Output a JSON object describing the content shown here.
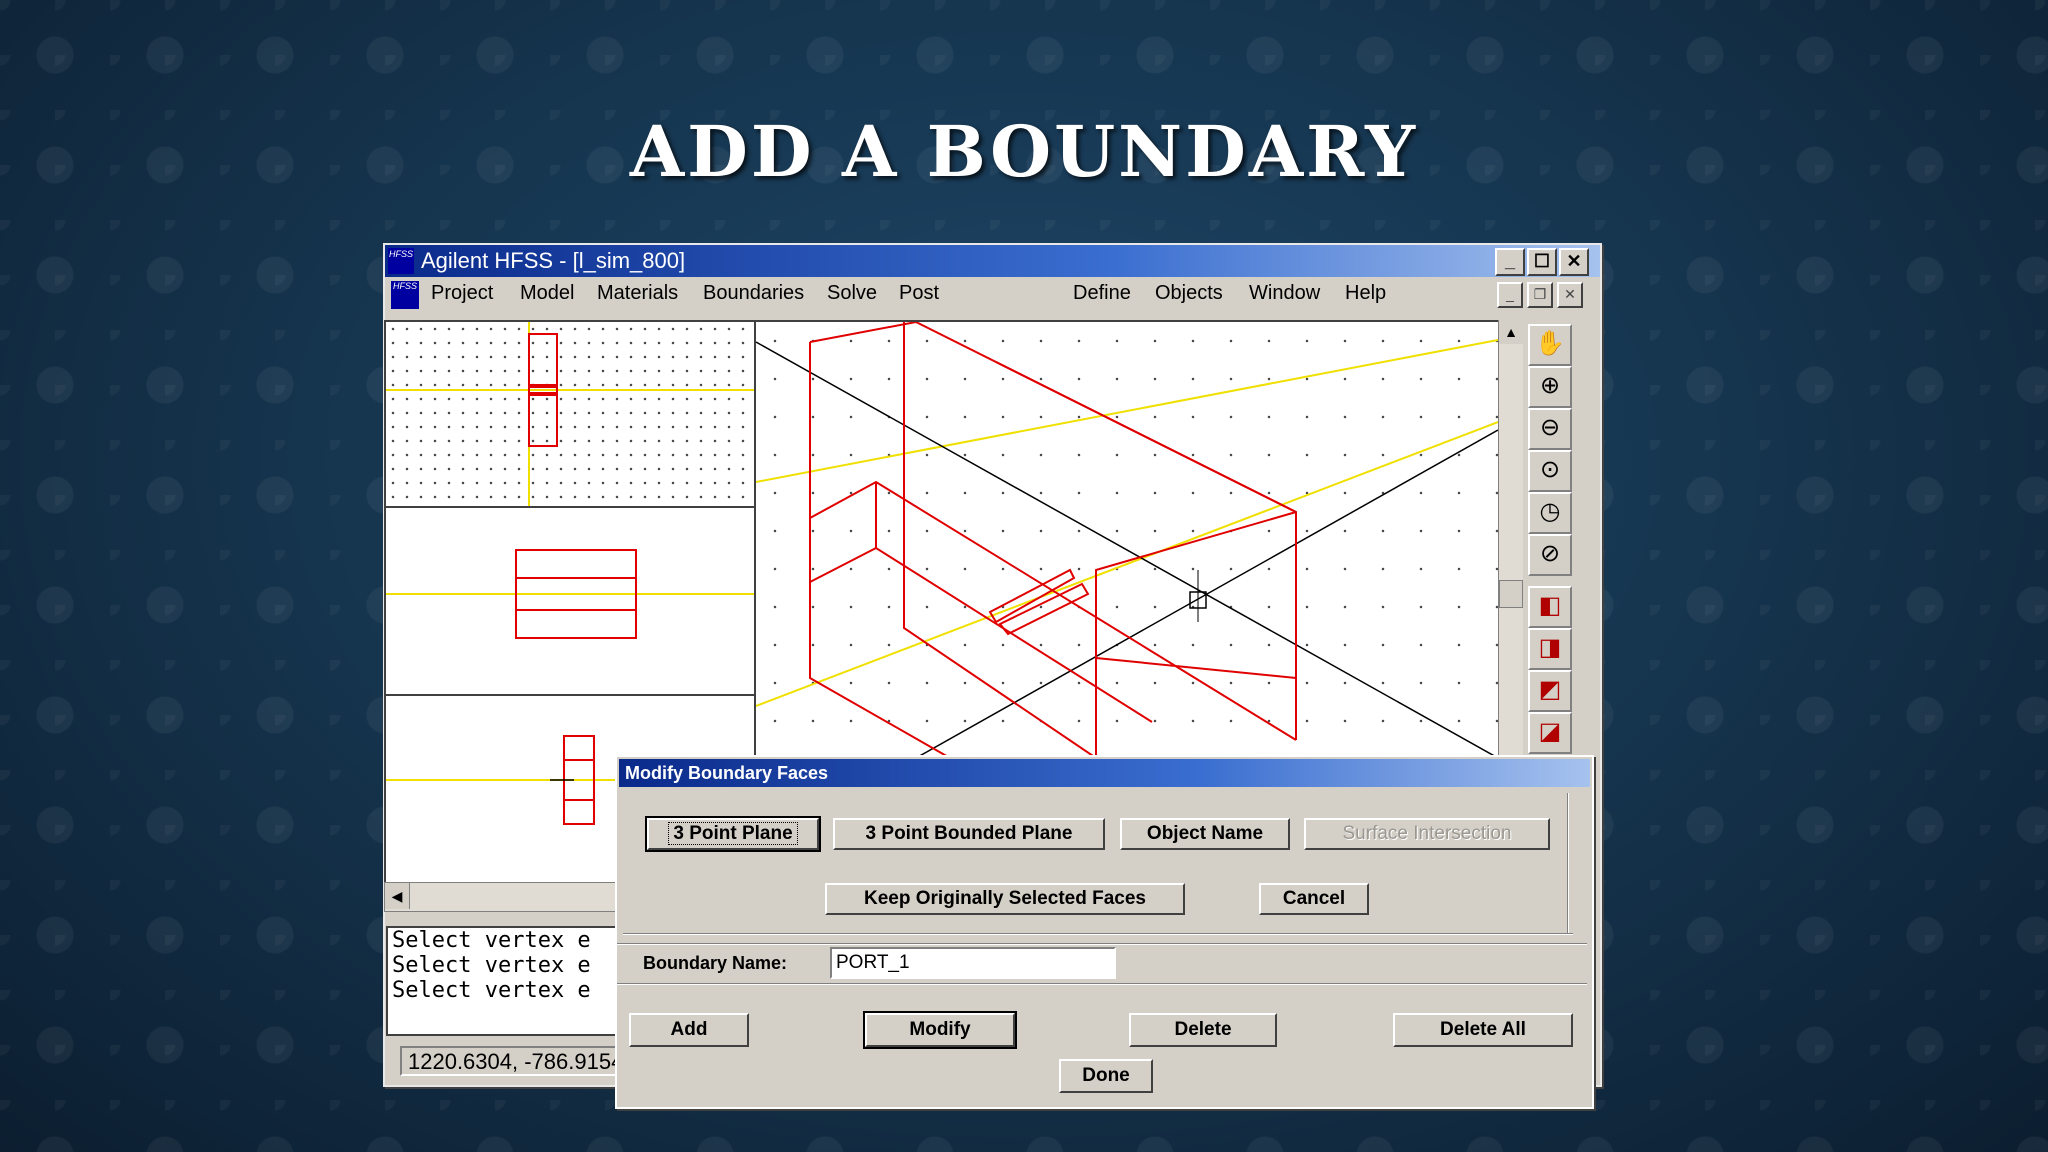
{
  "slide": {
    "title": "ADD A BOUNDARY"
  },
  "window": {
    "title": "Agilent HFSS - [l_sim_800]",
    "logo_text": "HFSS",
    "controls": {
      "minimize": "_",
      "maximize": "☐",
      "close": "✕"
    }
  },
  "menubar": {
    "items": [
      "Project",
      "Model",
      "Materials",
      "Boundaries",
      "Solve",
      "Post",
      "Define",
      "Objects",
      "Window",
      "Help"
    ],
    "mdi_controls": {
      "minimize": "_",
      "restore": "❐",
      "close": "✕"
    }
  },
  "toolbar": {
    "icons": [
      "pan-hand-icon",
      "zoom-in-icon",
      "zoom-out-icon",
      "zoom-window-icon",
      "zoom-previous-icon",
      "fit-all-icon",
      "view-iso-icon",
      "view-front-icon",
      "view-side-icon",
      "view-top-icon"
    ]
  },
  "console": {
    "lines": [
      "Select vertex e",
      "Select vertex e",
      "Select vertex e"
    ]
  },
  "status": {
    "coords": "1220.6304, -786.9154"
  },
  "dialog": {
    "title": "Modify Boundary Faces",
    "buttons": {
      "three_point_plane": "3 Point Plane",
      "three_point_bounded_plane": "3 Point Bounded Plane",
      "object_name": "Object Name",
      "surface_intersection": "Surface Intersection",
      "keep_original": "Keep Originally Selected Faces",
      "cancel": "Cancel"
    },
    "boundary_name_label": "Boundary Name:",
    "boundary_name_value": "PORT_1",
    "actions": {
      "add": "Add",
      "modify": "Modify",
      "delete": "Delete",
      "delete_all": "Delete All",
      "done": "Done"
    }
  }
}
